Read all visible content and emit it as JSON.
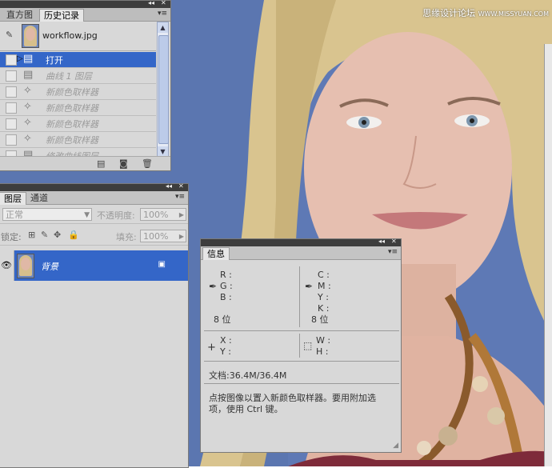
{
  "watermark": {
    "main": "思缘设计论坛",
    "site": "WWW.MISSYUAN.COM"
  },
  "history": {
    "tabs": [
      {
        "label": "直方图"
      },
      {
        "label": "历史记录"
      }
    ],
    "snapshot": {
      "name": "workflow.jpg"
    },
    "items": [
      {
        "label": "打开",
        "selected": true
      },
      {
        "label": "曲线 1 图层",
        "selected": false
      },
      {
        "label": "新颜色取样器",
        "selected": false
      },
      {
        "label": "新颜色取样器",
        "selected": false
      },
      {
        "label": "新颜色取样器",
        "selected": false
      },
      {
        "label": "新颜色取样器",
        "selected": false
      },
      {
        "label": "修改曲线图层",
        "selected": false
      }
    ]
  },
  "layers": {
    "tabs": [
      {
        "label": "图层"
      },
      {
        "label": "通道"
      }
    ],
    "blend_mode": "正常",
    "opacity_label": "不透明度:",
    "opacity_value": "100%",
    "lock_label": "锁定:",
    "fill_label": "填充:",
    "fill_value": "100%",
    "items": [
      {
        "name": "背景",
        "visible": true
      }
    ]
  },
  "info": {
    "tab": "信息",
    "rgb": {
      "r": "R :",
      "g": "G :",
      "b": "B :"
    },
    "cmyk": {
      "c": "C :",
      "m": "M :",
      "y": "Y :",
      "k": "K :"
    },
    "bits_left": "8 位",
    "bits_right": "8 位",
    "xy": {
      "x": "X :",
      "y": "Y :"
    },
    "wh": {
      "w": "W :",
      "h": "H :"
    },
    "doc": "文档:36.4M/36.4M",
    "hint_line1": "点按图像以置入新颜色取样器。要用附加选",
    "hint_line2": "项，使用 Ctrl 键。"
  },
  "colors": {
    "selection": "#3466c8",
    "panel": "#d8d8d8",
    "photo_bg": "#5d78b4"
  }
}
